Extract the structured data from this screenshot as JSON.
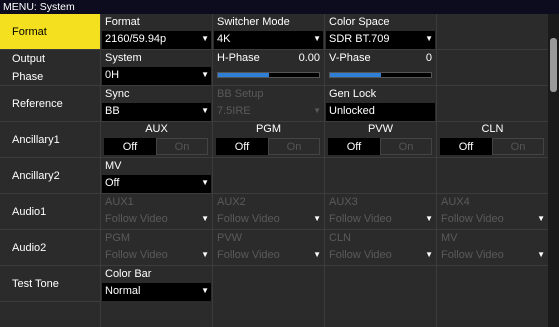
{
  "menu_title": "MENU: System",
  "rows": {
    "format": "Format",
    "output_phase_line1": "Output",
    "output_phase_line2": "Phase",
    "reference": "Reference",
    "ancillary1": "Ancillary1",
    "ancillary2": "Ancillary2",
    "audio1": "Audio1",
    "audio2": "Audio2",
    "test_tone": "Test Tone"
  },
  "format_row": {
    "format_label": "Format",
    "format_value": "2160/59.94p",
    "switcher_label": "Switcher Mode",
    "switcher_value": "4K",
    "color_label": "Color Space",
    "color_value": "SDR BT.709"
  },
  "output_row": {
    "system_label": "System",
    "system_value": "0H",
    "hphase_label": "H-Phase",
    "hphase_value": "0.00",
    "hphase_level": 0.5,
    "vphase_label": "V-Phase",
    "vphase_value": "0",
    "vphase_level": 0.5
  },
  "reference_row": {
    "sync_label": "Sync",
    "sync_value": "BB",
    "bb_label": "BB Setup",
    "bb_value": "7.5IRE",
    "genlock_label": "Gen Lock",
    "genlock_value": "Unlocked"
  },
  "ancillary1_row": {
    "off": "Off",
    "on": "On",
    "channels": [
      "AUX",
      "PGM",
      "PVW",
      "CLN"
    ]
  },
  "ancillary2_row": {
    "mv_label": "MV",
    "mv_value": "Off"
  },
  "audio1_row": {
    "labels": [
      "AUX1",
      "AUX2",
      "AUX3",
      "AUX4"
    ],
    "value": "Follow Video"
  },
  "audio2_row": {
    "labels": [
      "PGM",
      "PVW",
      "CLN",
      "MV"
    ],
    "value": "Follow Video"
  },
  "test_tone_row": {
    "label": "Color Bar",
    "value": "Normal"
  },
  "arrow_glyph": "▼"
}
